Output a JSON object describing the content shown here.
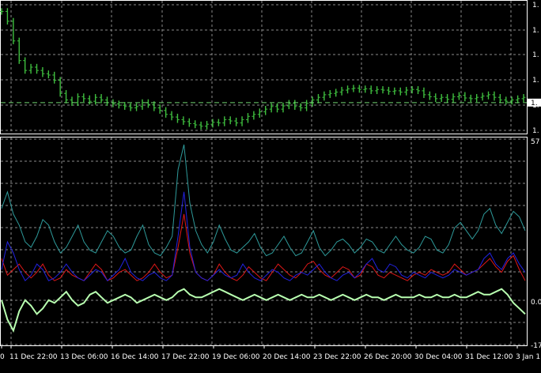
{
  "colors": {
    "background": "#000000",
    "grid": "#8a8a8a",
    "frame": "#ffffff",
    "price_bars": "#3fbf3f",
    "price_level_line": "#6fd36f",
    "indicator_teal": "#2e9a9a",
    "indicator_blue": "#2222e0",
    "indicator_red": "#e01818",
    "indicator_light_green": "#b8ffb0"
  },
  "price_pane": {
    "y_tick_labels": [
      "1.",
      "1.",
      "1.",
      "1.",
      "1.",
      "1."
    ],
    "current_price_tag": "1.",
    "close_series": [
      1.3745,
      1.373,
      1.37,
      1.367,
      1.3655,
      1.366,
      1.3655,
      1.365,
      1.3648,
      1.364,
      1.362,
      1.361,
      1.3606,
      1.3615,
      1.3612,
      1.3608,
      1.3614,
      1.361,
      1.3606,
      1.3604,
      1.3602,
      1.36,
      1.3598,
      1.36,
      1.3606,
      1.3603,
      1.3598,
      1.3594,
      1.3588,
      1.3584,
      1.358,
      1.3577,
      1.3574,
      1.3572,
      1.357,
      1.3573,
      1.3576,
      1.3575,
      1.358,
      1.3578,
      1.3575,
      1.358,
      1.3585,
      1.3588,
      1.3592,
      1.3596,
      1.36,
      1.3596,
      1.3601,
      1.3605,
      1.36,
      1.3598,
      1.3605,
      1.361,
      1.3614,
      1.3618,
      1.362,
      1.3622,
      1.3625,
      1.3627,
      1.3628,
      1.3626,
      1.3627,
      1.3624,
      1.3626,
      1.3625,
      1.3623,
      1.3624,
      1.3622,
      1.3625,
      1.3626,
      1.3624,
      1.3618,
      1.3615,
      1.3612,
      1.3614,
      1.3611,
      1.3615,
      1.3617,
      1.3613,
      1.3612,
      1.3614,
      1.3616,
      1.3618,
      1.3614,
      1.361,
      1.3608,
      1.361,
      1.3612,
      1.3614
    ],
    "price_range": [
      1.356,
      1.376
    ],
    "level_line_price": 1.3606
  },
  "indicator_pane": {
    "y_tick_labels": [
      "57",
      "0.0",
      "-17"
    ],
    "value_range": [
      -17,
      57
    ],
    "teal_series": [
      32,
      38,
      30,
      26,
      20,
      18,
      22,
      28,
      26,
      20,
      16,
      18,
      22,
      26,
      20,
      17,
      16,
      20,
      24,
      22,
      18,
      16,
      17,
      22,
      26,
      19,
      16,
      15,
      18,
      22,
      46,
      55,
      34,
      24,
      19,
      16,
      20,
      26,
      21,
      17,
      16,
      18,
      20,
      23,
      18,
      15,
      16,
      19,
      22,
      18,
      15,
      16,
      20,
      24,
      18,
      15,
      17,
      20,
      21,
      19,
      16,
      18,
      21,
      20,
      17,
      16,
      19,
      22,
      19,
      17,
      16,
      18,
      22,
      21,
      17,
      16,
      19,
      25,
      27,
      24,
      21,
      24,
      30,
      32,
      26,
      23,
      27,
      31,
      29,
      24
    ],
    "blue_series": [
      10,
      20,
      16,
      10,
      6,
      8,
      12,
      10,
      6,
      7,
      9,
      12,
      9,
      7,
      6,
      8,
      10,
      9,
      6,
      8,
      10,
      14,
      9,
      7,
      6,
      8,
      9,
      7,
      6,
      8,
      22,
      38,
      18,
      9,
      7,
      6,
      8,
      10,
      8,
      7,
      8,
      12,
      9,
      7,
      6,
      8,
      10,
      9,
      7,
      6,
      8,
      9,
      8,
      10,
      12,
      9,
      7,
      6,
      8,
      9,
      7,
      9,
      12,
      14,
      10,
      9,
      12,
      11,
      8,
      7,
      9,
      8,
      7,
      9,
      8,
      7,
      8,
      10,
      9,
      8,
      9,
      10,
      14,
      16,
      12,
      10,
      14,
      16,
      12,
      9
    ],
    "red_series": [
      14,
      8,
      10,
      12,
      9,
      7,
      9,
      12,
      8,
      6,
      7,
      10,
      8,
      7,
      6,
      9,
      12,
      10,
      6,
      7,
      9,
      10,
      8,
      6,
      7,
      9,
      12,
      9,
      7,
      8,
      18,
      30,
      16,
      9,
      7,
      6,
      8,
      12,
      9,
      7,
      6,
      8,
      11,
      9,
      7,
      6,
      9,
      12,
      10,
      8,
      7,
      9,
      12,
      13,
      10,
      8,
      7,
      9,
      11,
      10,
      7,
      8,
      12,
      11,
      8,
      7,
      9,
      8,
      7,
      6,
      8,
      9,
      8,
      10,
      9,
      8,
      9,
      12,
      10,
      8,
      9,
      10,
      12,
      14,
      11,
      9,
      13,
      15,
      10,
      6
    ],
    "light_green_series": [
      -1,
      -8,
      -12,
      -5,
      -1,
      -3,
      -6,
      -4,
      -1,
      -2,
      0,
      2,
      -1,
      -3,
      -2,
      1,
      2,
      0,
      -2,
      -1,
      0,
      1,
      0,
      -2,
      -1,
      0,
      1,
      0,
      -1,
      0,
      2,
      3,
      1,
      0,
      0,
      1,
      2,
      3,
      2,
      1,
      0,
      -1,
      0,
      1,
      0,
      -1,
      0,
      1,
      0,
      -1,
      0,
      1,
      0,
      0,
      1,
      0,
      -1,
      0,
      1,
      0,
      -1,
      0,
      1,
      0,
      0,
      -1,
      0,
      1,
      0,
      0,
      0,
      1,
      0,
      0,
      1,
      0,
      0,
      1,
      0,
      0,
      1,
      2,
      1,
      1,
      2,
      3,
      1,
      -2,
      -4,
      -6
    ]
  },
  "x_axis": {
    "labels": [
      "0",
      "11 Dec 22:00",
      "13 Dec 06:00",
      "16 Dec 14:00",
      "17 Dec 22:00",
      "19 Dec 06:00",
      "20 Dec 14:00",
      "23 Dec 22:00",
      "26 Dec 20:00",
      "30 Dec 04:00",
      "31 Dec 12:00",
      "3 Jan 1"
    ]
  }
}
